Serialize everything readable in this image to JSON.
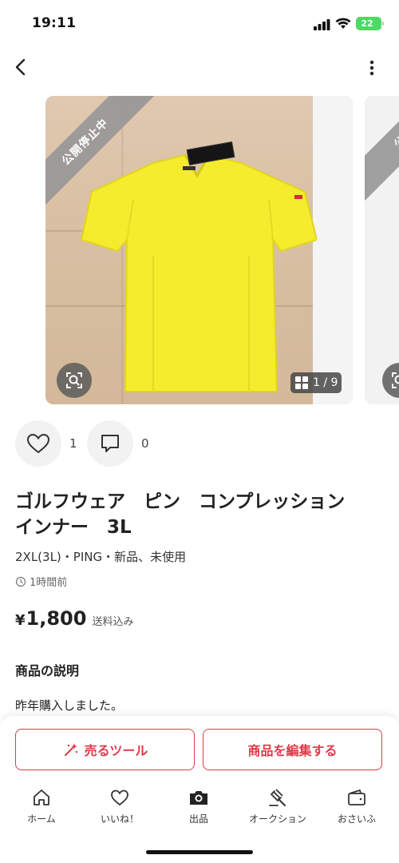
{
  "status_bar": {
    "time": "19:11",
    "battery": "22"
  },
  "carousel": {
    "ribbon_text": "公開停止中",
    "ribbon_text_next": "公",
    "counter": "1 / 9"
  },
  "stats": {
    "likes": "1",
    "comments": "0"
  },
  "item": {
    "title": "ゴルフウェア　ピン　コンプレッション\nインナー　3L",
    "meta": "2XL(3L)・PING・新品、未使用",
    "posted": "1時間前",
    "currency": "¥",
    "price": "1,800",
    "shipping": "送料込み"
  },
  "description": {
    "heading": "商品の説明",
    "body": "昨年購入しました。"
  },
  "actions": {
    "sell_tool": "売るツール",
    "edit": "商品を編集する"
  },
  "tabs": [
    {
      "label": "ホーム",
      "icon": "home-icon"
    },
    {
      "label": "いいね！",
      "icon": "heart-icon"
    },
    {
      "label": "出品",
      "icon": "camera-icon"
    },
    {
      "label": "オークション",
      "icon": "gavel-icon"
    },
    {
      "label": "おさいふ",
      "icon": "wallet-icon"
    }
  ],
  "colors": {
    "accent": "#e03a49",
    "shirt": "#f4ec2c",
    "ribbon": "#959595"
  }
}
